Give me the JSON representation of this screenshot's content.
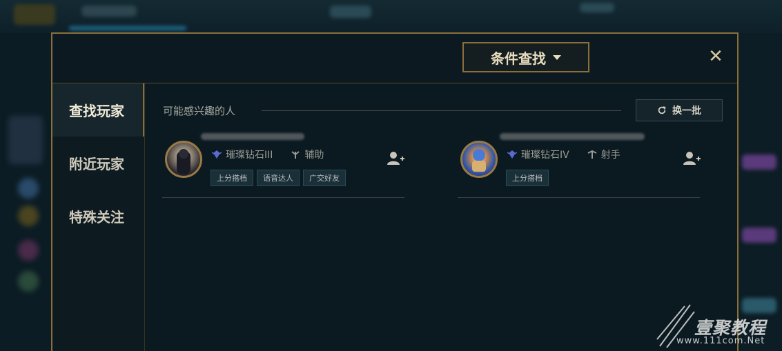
{
  "header": {
    "condition_search_label": "条件查找",
    "close_label": "✕"
  },
  "sidebar": {
    "items": [
      {
        "label": "查找玩家",
        "active": true
      },
      {
        "label": "附近玩家",
        "active": false
      },
      {
        "label": "特殊关注",
        "active": false
      }
    ]
  },
  "section": {
    "title": "可能感兴趣的人",
    "refresh_label": "换一批"
  },
  "players": [
    {
      "rank": "璀璨钻石III",
      "role": "辅助",
      "role_icon": "support-icon",
      "tags": [
        "上分搭档",
        "语音达人",
        "广交好友"
      ]
    },
    {
      "rank": "璀璨钻石IV",
      "role": "射手",
      "role_icon": "marksman-icon",
      "tags": [
        "上分搭档"
      ]
    }
  ],
  "watermark": {
    "brand": "壹聚教程",
    "url": "www.111com.Net"
  },
  "colors": {
    "gold_border": "#8a6f3a",
    "panel_bg": "#0c1a21",
    "tag_bg": "#1a3038"
  }
}
